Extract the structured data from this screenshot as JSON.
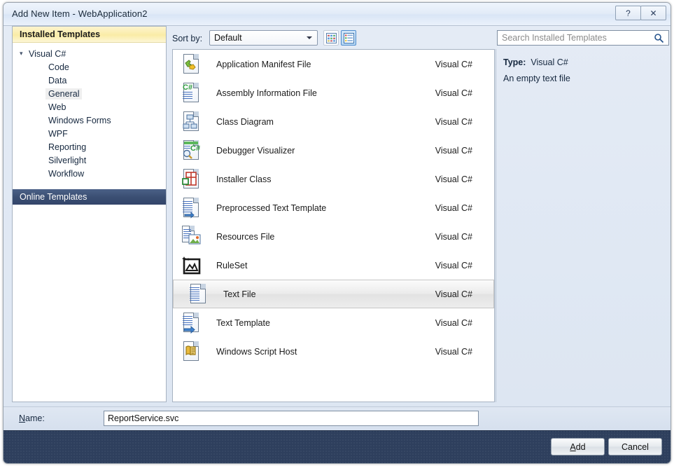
{
  "window": {
    "title": "Add New Item - WebApplication2",
    "help_button": "?",
    "close_button": "✕"
  },
  "sidebar": {
    "header": "Installed Templates",
    "root": {
      "label": "Visual C#",
      "expander": "▲"
    },
    "items": [
      {
        "label": "Code",
        "selected": false
      },
      {
        "label": "Data",
        "selected": false
      },
      {
        "label": "General",
        "selected": true
      },
      {
        "label": "Web",
        "selected": false
      },
      {
        "label": "Windows Forms",
        "selected": false
      },
      {
        "label": "WPF",
        "selected": false
      },
      {
        "label": "Reporting",
        "selected": false
      },
      {
        "label": "Silverlight",
        "selected": false
      },
      {
        "label": "Workflow",
        "selected": false
      }
    ],
    "online_templates": "Online Templates"
  },
  "toolbar": {
    "sort_by_label": "Sort by:",
    "sort_by_value": "Default",
    "view_large_icons": "large-icons-view",
    "view_list": "list-view",
    "view_list_active": true
  },
  "search": {
    "placeholder": "Search Installed Templates",
    "value": "",
    "icon": "search-icon"
  },
  "templates": {
    "language_column": "Visual C#",
    "items": [
      {
        "name": "Application Manifest File",
        "language": "Visual C#",
        "icon": "manifest-file-icon",
        "selected": false
      },
      {
        "name": "Assembly Information File",
        "language": "Visual C#",
        "icon": "assembly-info-file-icon",
        "selected": false
      },
      {
        "name": "Class Diagram",
        "language": "Visual C#",
        "icon": "class-diagram-icon",
        "selected": false
      },
      {
        "name": "Debugger Visualizer",
        "language": "Visual C#",
        "icon": "debugger-visualizer-icon",
        "selected": false
      },
      {
        "name": "Installer Class",
        "language": "Visual C#",
        "icon": "installer-class-icon",
        "selected": false
      },
      {
        "name": "Preprocessed Text Template",
        "language": "Visual C#",
        "icon": "preprocessed-text-template-icon",
        "selected": false
      },
      {
        "name": "Resources File",
        "language": "Visual C#",
        "icon": "resources-file-icon",
        "selected": false
      },
      {
        "name": "RuleSet",
        "language": "Visual C#",
        "icon": "ruleset-icon",
        "selected": false
      },
      {
        "name": "Text File",
        "language": "Visual C#",
        "icon": "text-file-icon",
        "selected": true
      },
      {
        "name": "Text Template",
        "language": "Visual C#",
        "icon": "text-template-icon",
        "selected": false
      },
      {
        "name": "Windows Script Host",
        "language": "Visual C#",
        "icon": "windows-script-host-icon",
        "selected": false
      }
    ]
  },
  "details": {
    "type_label": "Type:",
    "type_value": "Visual C#",
    "description": "An empty text file"
  },
  "name_field": {
    "label": "Name:",
    "label_accel": "N",
    "label_rest": "ame:",
    "value": "ReportService.svc"
  },
  "footer": {
    "add_label": "Add",
    "add_accel": "A",
    "add_rest": "dd",
    "cancel_label": "Cancel"
  },
  "colors": {
    "titlebar": "#e3ecf8",
    "footer": "#2e3f5d",
    "tree_header": "#faeca6",
    "online_templates": "#3b4f73",
    "accent_blue": "#4e8ccd",
    "body": "#e4ebf5"
  }
}
